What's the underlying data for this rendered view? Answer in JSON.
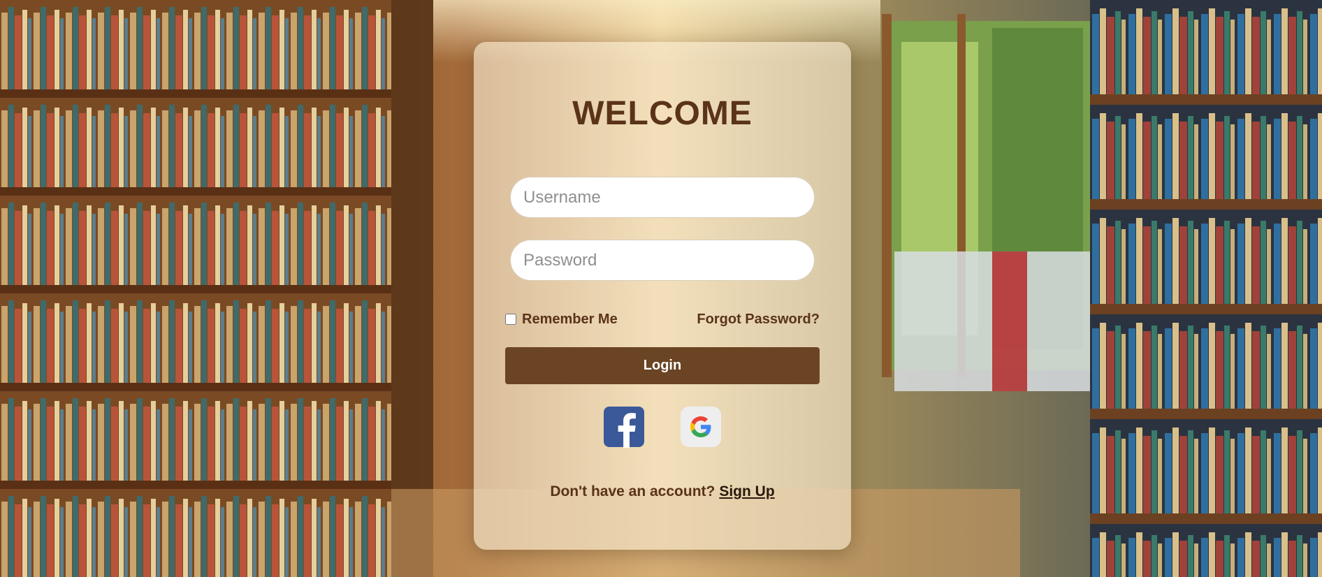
{
  "login_card": {
    "title": "WELCOME",
    "username_placeholder": "Username",
    "password_placeholder": "Password",
    "remember_label": "Remember Me",
    "forgot_label": "Forgot Password?",
    "login_label": "Login",
    "signup_prompt": "Don't have an account?",
    "signup_link": "Sign Up",
    "social_icons": [
      "facebook-icon",
      "google-icon"
    ]
  },
  "colors": {
    "brand_brown": "#6a4423",
    "text_brown": "#5a3318",
    "facebook_blue": "#3b5998"
  }
}
